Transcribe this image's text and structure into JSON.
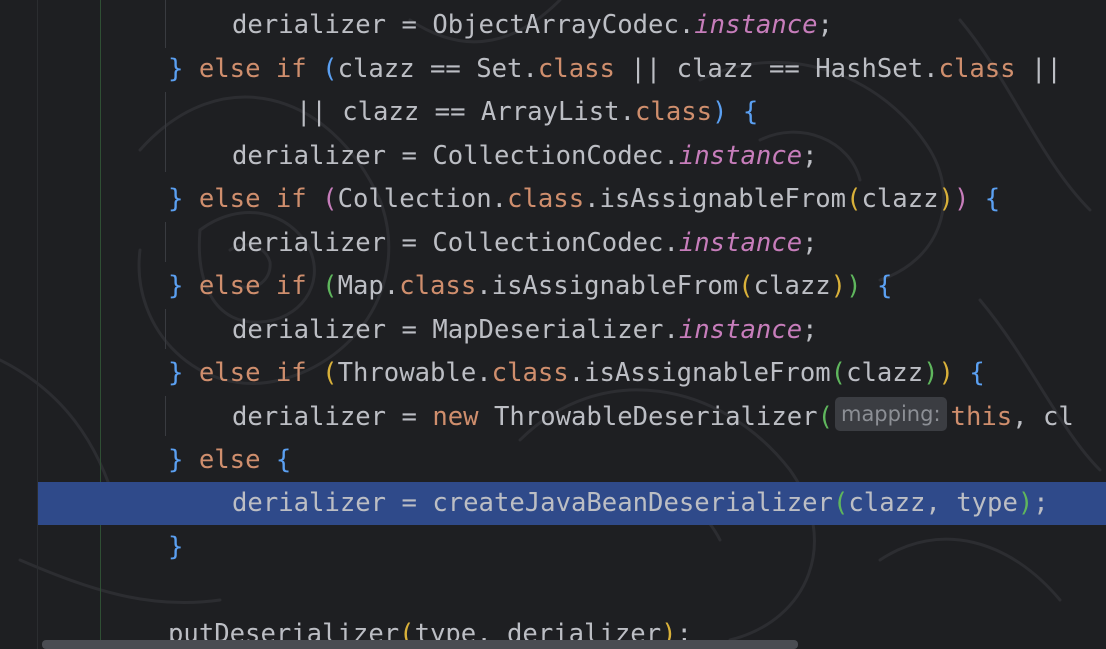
{
  "editor": {
    "lines": [
      {
        "id": 1,
        "text": "derializer = ObjectArrayCodec.instance;"
      },
      {
        "id": 2,
        "text": "} else if (clazz == Set.class || clazz == HashSet.class ||"
      },
      {
        "id": 3,
        "text": "|| clazz == ArrayList.class) {"
      },
      {
        "id": 4,
        "text": "derializer = CollectionCodec.instance;"
      },
      {
        "id": 5,
        "text": "} else if (Collection.class.isAssignableFrom(clazz)) {"
      },
      {
        "id": 6,
        "text": "derializer = CollectionCodec.instance;"
      },
      {
        "id": 7,
        "text": "} else if (Map.class.isAssignableFrom(clazz)) {"
      },
      {
        "id": 8,
        "text": "derializer = MapDeserializer.instance;"
      },
      {
        "id": 9,
        "text": "} else if (Throwable.class.isAssignableFrom(clazz)) {"
      },
      {
        "id": 10,
        "text": "derializer = new ThrowableDeserializer(mapping: this, cl"
      },
      {
        "id": 11,
        "text": "} else {"
      },
      {
        "id": 12,
        "text": "derializer = createJavaBeanDeserializer(clazz, type);",
        "selected": true
      },
      {
        "id": 13,
        "text": "}"
      },
      {
        "id": 14,
        "text": ""
      },
      {
        "id": 15,
        "text": "putDeserializer(type, derializer);"
      }
    ],
    "inlay_hint": "mapping:",
    "selected_line": 12,
    "colors": {
      "background": "#1e1f22",
      "selection": "#2f4a8a",
      "keyword": "#cf8e6d",
      "static_field": "#c77dbb",
      "text": "#bcbec4",
      "bracket_level_1": "#5ba0f2",
      "bracket_level_2": "#c77dbb",
      "bracket_level_3": "#d9b13a",
      "bracket_level_4": "#5fb65d"
    }
  }
}
